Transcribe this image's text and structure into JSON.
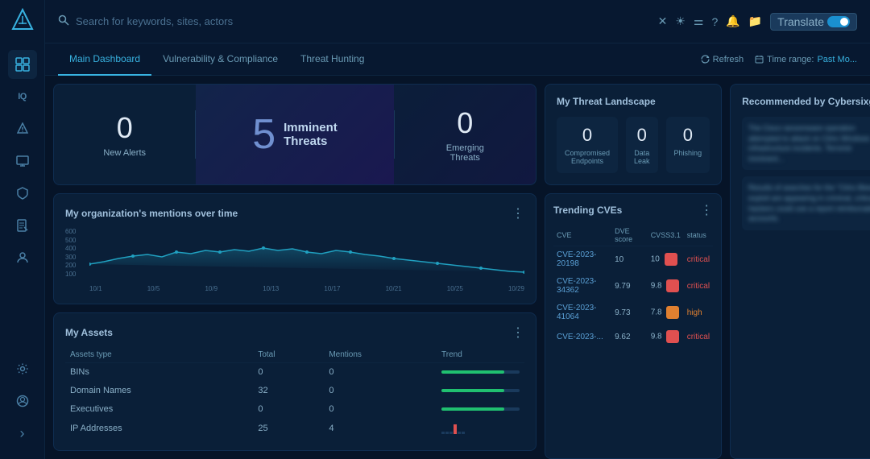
{
  "sidebar": {
    "logo": "✦",
    "items": [
      {
        "name": "grid",
        "icon": "⊞",
        "active": true
      },
      {
        "name": "iq",
        "label": "IQ"
      },
      {
        "name": "alert",
        "icon": "△"
      },
      {
        "name": "eye",
        "icon": "◉"
      },
      {
        "name": "shield",
        "icon": "⬡"
      },
      {
        "name": "doc",
        "icon": "☰"
      },
      {
        "name": "users",
        "icon": "⚇"
      }
    ],
    "bottom": [
      {
        "name": "settings",
        "icon": "⚙"
      },
      {
        "name": "account",
        "icon": "⊙"
      },
      {
        "name": "chevron",
        "icon": "›"
      }
    ]
  },
  "topbar": {
    "search_placeholder": "Search for keywords, sites, actors",
    "actions": [
      "✕",
      "☀",
      "☰",
      "?",
      "🔔",
      "📁"
    ],
    "translate_label": "Translate"
  },
  "tabs": {
    "items": [
      {
        "label": "Main Dashboard",
        "active": true
      },
      {
        "label": "Vulnerability & Compliance",
        "active": false
      },
      {
        "label": "Threat Hunting",
        "active": false
      }
    ],
    "refresh_label": "Refresh",
    "time_range_label": "Time range:",
    "time_range_value": "Past Mo..."
  },
  "alert_summary": {
    "new_alerts_count": "0",
    "new_alerts_label": "New Alerts",
    "imminent_count": "5",
    "imminent_label1": "Imminent",
    "imminent_label2": "Threats",
    "emerging_count": "0",
    "emerging_label1": "Emerging",
    "emerging_label2": "Threats"
  },
  "threat_landscape": {
    "title": "My Threat Landscape",
    "metrics": [
      {
        "value": "0",
        "label": "Compromised Endpoints"
      },
      {
        "value": "0",
        "label": "Data Leak"
      },
      {
        "value": "0",
        "label": "Phishing"
      }
    ]
  },
  "mentions_chart": {
    "title": "My organization's mentions over time",
    "y_labels": [
      "600",
      "500",
      "400",
      "300",
      "200",
      "100"
    ],
    "x_labels": [
      "10/1",
      "10/5",
      "10/9",
      "10/13",
      "10/17",
      "10/21",
      "10/25",
      "10/29"
    ]
  },
  "assets": {
    "title": "My Assets",
    "menu_icon": "⋮",
    "columns": [
      "Assets type",
      "Total",
      "Mentions",
      "Trend"
    ],
    "rows": [
      {
        "type": "BINs",
        "total": "0",
        "mentions": "0",
        "trend_type": "flat_green"
      },
      {
        "type": "Domain Names",
        "total": "32",
        "mentions": "0",
        "trend_type": "flat_green"
      },
      {
        "type": "Executives",
        "total": "0",
        "mentions": "0",
        "trend_type": "flat_green"
      },
      {
        "type": "IP Addresses",
        "total": "25",
        "mentions": "4",
        "trend_type": "spike_red"
      }
    ]
  },
  "trending_cves": {
    "title": "Trending CVEs",
    "menu_icon": "⋮",
    "columns": [
      "CVE",
      "DVE score",
      "CVSS3.1",
      "status"
    ],
    "rows": [
      {
        "cve": "CVE-2023-20198",
        "dve": "10",
        "cvss": "10",
        "badge": "critical",
        "status": "critical"
      },
      {
        "cve": "CVE-2023-34362",
        "dve": "9.79",
        "cvss": "9.8",
        "badge": "critical",
        "status": "critical"
      },
      {
        "cve": "CVE-2023-41064",
        "dve": "9.73",
        "cvss": "7.8",
        "badge": "high",
        "status": "high"
      },
      {
        "cve": "CVE-2023-...",
        "dve": "9.62",
        "cvss": "9.8",
        "badge": "critical",
        "status": "critical"
      }
    ]
  },
  "recommended": {
    "title": "Recommended by Cybersixgill",
    "items": [
      {
        "text": "The Cisco ransomware operation attempted to attack on Citrix Windows infrastructure incidents. Terrorist imminent..."
      },
      {
        "text": "Results of searches for the \"Citrix Bleed\" exploit are appearing in criminal, critical hackers could use a report reimbursable accounts."
      }
    ]
  }
}
